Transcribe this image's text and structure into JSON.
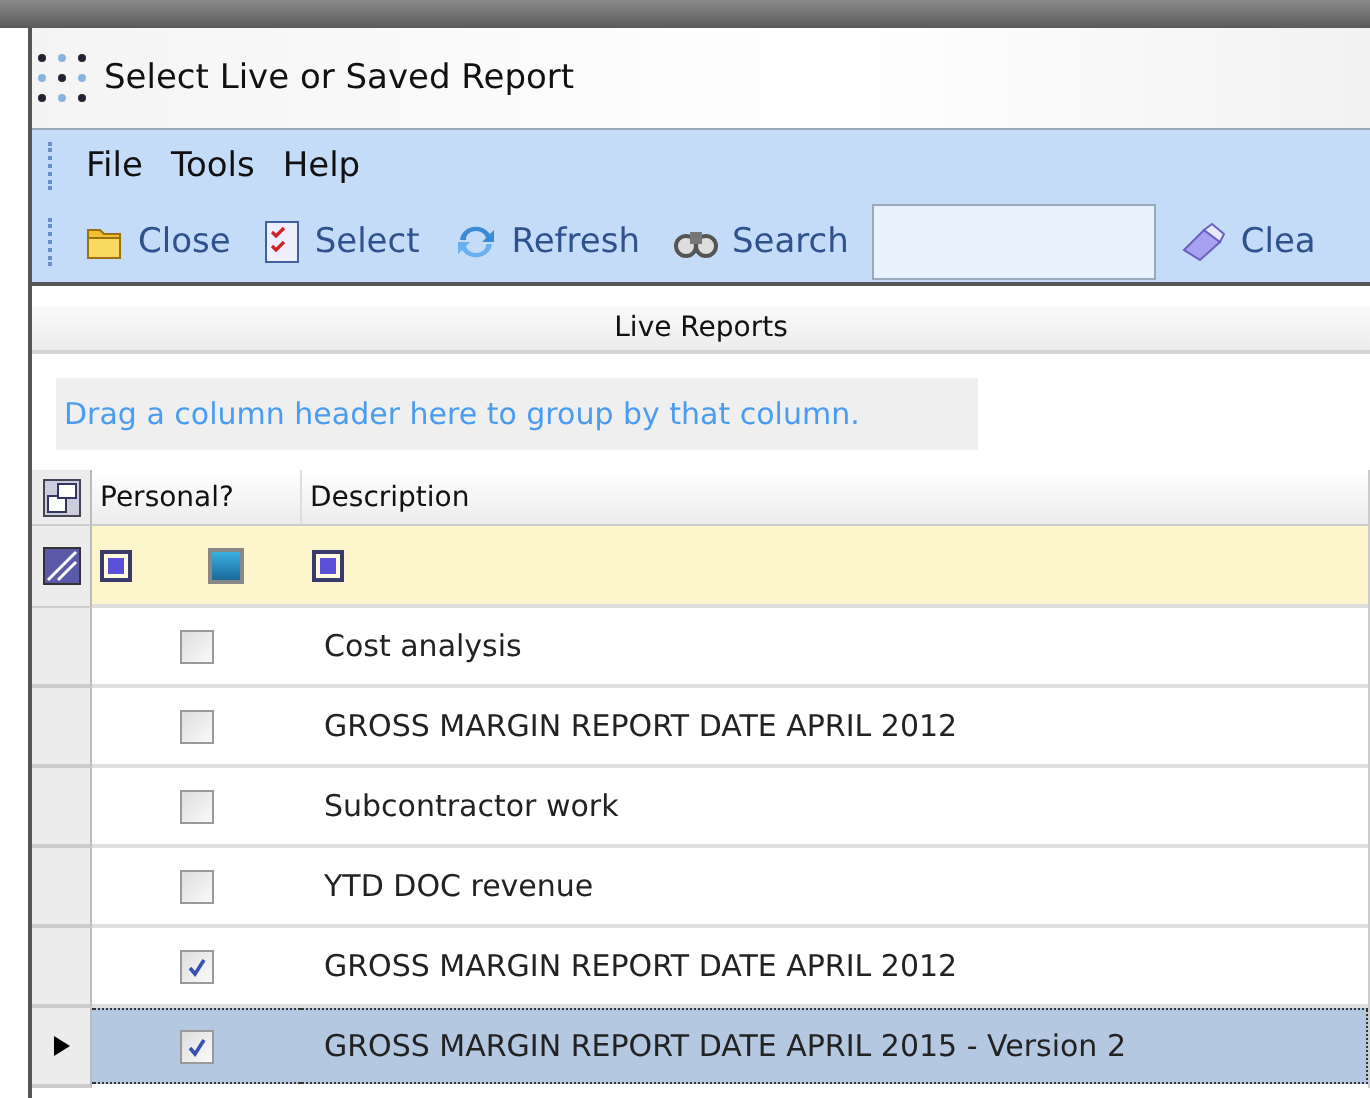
{
  "window": {
    "title": "Select Live or Saved Report"
  },
  "menu": [
    "File",
    "Tools",
    "Help"
  ],
  "toolbar": [
    {
      "kind": "folder",
      "label": "Close"
    },
    {
      "kind": "checklist",
      "label": "Select"
    },
    {
      "kind": "refresh",
      "label": "Refresh"
    },
    {
      "kind": "binoculars",
      "label": "Search"
    },
    {
      "kind": "field"
    },
    {
      "kind": "eraser",
      "label": "Clea"
    }
  ],
  "panel_title": "Live Reports",
  "group_hint": "Drag a column header here to group by that column.",
  "columns": [
    "Personal?",
    "Description"
  ],
  "rows": [
    {
      "personal": false,
      "description": "Cost analysis",
      "selected": false
    },
    {
      "personal": false,
      "description": "GROSS MARGIN REPORT DATE APRIL 2012",
      "selected": false
    },
    {
      "personal": false,
      "description": "Subcontractor work",
      "selected": false
    },
    {
      "personal": false,
      "description": "YTD DOC revenue",
      "selected": false
    },
    {
      "personal": true,
      "description": "GROSS MARGIN REPORT DATE APRIL 2012",
      "selected": false
    },
    {
      "personal": true,
      "description": "GROSS MARGIN REPORT DATE APRIL 2015 - Version 2",
      "selected": true
    }
  ]
}
